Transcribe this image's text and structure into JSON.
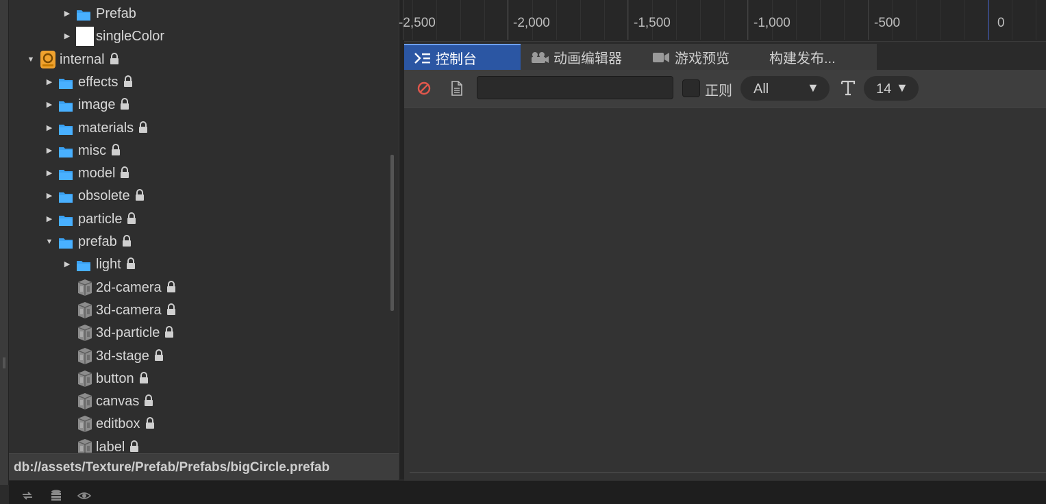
{
  "asset_tree": {
    "rows": [
      {
        "label": "Prefab",
        "locked": false,
        "icon": "folder-icon",
        "arrow": "right"
      },
      {
        "label": "singleColor",
        "locked": false,
        "icon": "white-texture-icon",
        "arrow": "right"
      },
      {
        "label": "internal",
        "locked": true,
        "icon": "database-icon",
        "arrow": "down"
      },
      {
        "label": "effects",
        "locked": true,
        "icon": "folder-icon",
        "arrow": "right"
      },
      {
        "label": "image",
        "locked": true,
        "icon": "folder-icon",
        "arrow": "right"
      },
      {
        "label": "materials",
        "locked": true,
        "icon": "folder-icon",
        "arrow": "right"
      },
      {
        "label": "misc",
        "locked": true,
        "icon": "folder-icon",
        "arrow": "right"
      },
      {
        "label": "model",
        "locked": true,
        "icon": "folder-icon",
        "arrow": "right"
      },
      {
        "label": "obsolete",
        "locked": true,
        "icon": "folder-icon",
        "arrow": "right"
      },
      {
        "label": "particle",
        "locked": true,
        "icon": "folder-icon",
        "arrow": "right"
      },
      {
        "label": "prefab",
        "locked": true,
        "icon": "folder-icon",
        "arrow": "down"
      },
      {
        "label": "light",
        "locked": true,
        "icon": "folder-icon",
        "arrow": "right"
      },
      {
        "label": "2d-camera",
        "locked": true,
        "icon": "prefab-cube-icon",
        "arrow": ""
      },
      {
        "label": "3d-camera",
        "locked": true,
        "icon": "prefab-cube-icon",
        "arrow": ""
      },
      {
        "label": "3d-particle",
        "locked": true,
        "icon": "prefab-cube-icon",
        "arrow": ""
      },
      {
        "label": "3d-stage",
        "locked": true,
        "icon": "prefab-cube-icon",
        "arrow": ""
      },
      {
        "label": "button",
        "locked": true,
        "icon": "prefab-cube-icon",
        "arrow": ""
      },
      {
        "label": "canvas",
        "locked": true,
        "icon": "prefab-cube-icon",
        "arrow": ""
      },
      {
        "label": "editbox",
        "locked": true,
        "icon": "prefab-cube-icon",
        "arrow": ""
      },
      {
        "label": "label",
        "locked": true,
        "icon": "prefab-cube-icon",
        "arrow": ""
      }
    ]
  },
  "path_bar": {
    "path": "db://assets/Texture/Prefab/Prefabs/bigCircle.prefab"
  },
  "ruler": {
    "labels": [
      "-2,500",
      "-2,000",
      "-1,500",
      "-1,000",
      "-500",
      "0"
    ]
  },
  "tabs": [
    {
      "label": "控制台",
      "active": true,
      "icon": "console-icon"
    },
    {
      "label": "动画编辑器",
      "active": false,
      "icon": "animation-icon"
    },
    {
      "label": "游戏预览",
      "active": false,
      "icon": "camera-icon"
    },
    {
      "label": "构建发布...",
      "active": false,
      "icon": ""
    }
  ],
  "console_toolbar": {
    "filter_value": "",
    "regex_label": "正则",
    "regex_checked": false,
    "level_value": "All",
    "level_caret": "▼",
    "font_size_value": "14",
    "font_size_caret": "▼"
  },
  "status_bar": {
    "icons": [
      "sync-icon",
      "database-stack-icon",
      "eye-icon"
    ]
  },
  "colors": {
    "accent": "#2b56a3",
    "folder": "#3aa1f2",
    "clear": "#e2574c"
  }
}
